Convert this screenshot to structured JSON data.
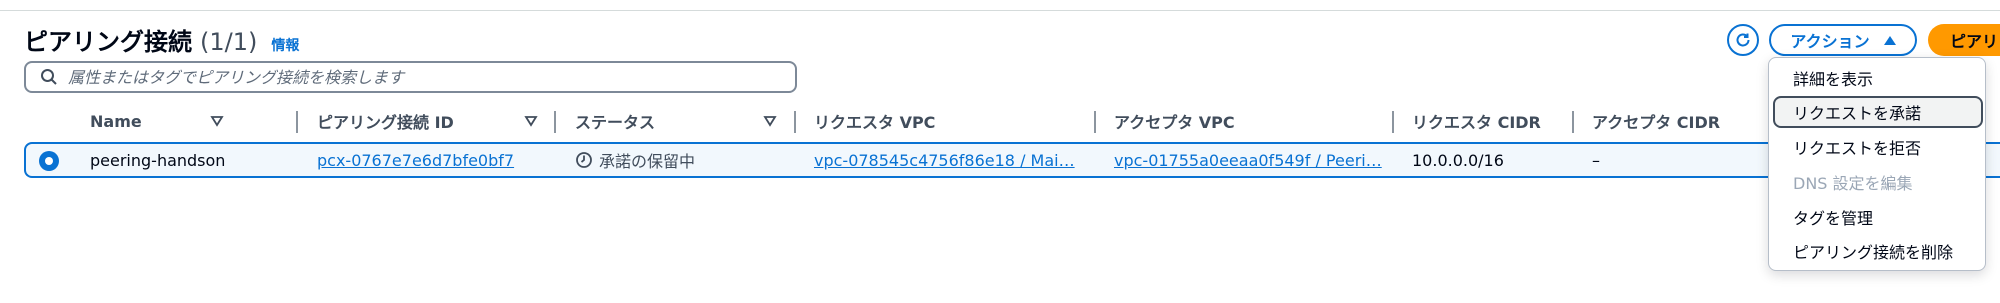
{
  "header": {
    "title": "ピアリング接続",
    "count": "(1/1)",
    "info_link": "情報",
    "refresh_icon": "refresh-icon",
    "actions_label": "アクション",
    "create_label": "ピアリ"
  },
  "search": {
    "placeholder": "属性またはタグでピアリング接続を検索します"
  },
  "table": {
    "columns": [
      "Name",
      "ピアリング接続 ID",
      "ステータス",
      "リクエスタ VPC",
      "アクセプタ VPC",
      "リクエスタ CIDR",
      "アクセプタ CIDR"
    ],
    "rows": [
      {
        "name": "peering-handson",
        "peering_id": "pcx-0767e7e6d7bfe0bf7",
        "status": "承諾の保留中",
        "requester_vpc": "vpc-078545c4756f86e18 / Mai…",
        "accepter_vpc": "vpc-01755a0eeaa0f549f / Peeri…",
        "requester_cidr": "10.0.0.0/16",
        "accepter_cidr": "–"
      }
    ]
  },
  "actions_menu": {
    "items": [
      {
        "label": "詳細を表示",
        "state": "normal"
      },
      {
        "label": "リクエストを承諾",
        "state": "active"
      },
      {
        "label": "リクエストを拒否",
        "state": "normal"
      },
      {
        "label": "DNS 設定を編集",
        "state": "disabled"
      },
      {
        "label": "タグを管理",
        "state": "normal"
      },
      {
        "label": "ピアリング接続を削除",
        "state": "normal"
      }
    ]
  },
  "colors": {
    "link": "#0972d3",
    "primary_button": "#ff9900",
    "selected_row_bg": "#f2f8fd",
    "disabled_text": "#9ba7b6"
  }
}
